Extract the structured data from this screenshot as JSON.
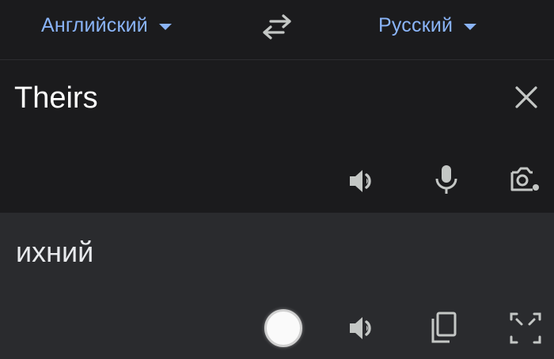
{
  "language_bar": {
    "source_language": "Английский",
    "target_language": "Русский",
    "swap_icon": "swap-arrows-icon",
    "accent_color": "#8ab4f8"
  },
  "source": {
    "text": "Theirs",
    "clear_icon": "close-icon",
    "actions": [
      "speaker-icon",
      "microphone-icon",
      "camera-icon"
    ]
  },
  "result": {
    "text": "ихний",
    "actions": [
      "speaker-icon",
      "copy-icon",
      "fullscreen-icon"
    ]
  },
  "colors": {
    "background": "#1b1b1d",
    "result_background": "#2a2b2e",
    "icon": "#c4c7c5"
  }
}
